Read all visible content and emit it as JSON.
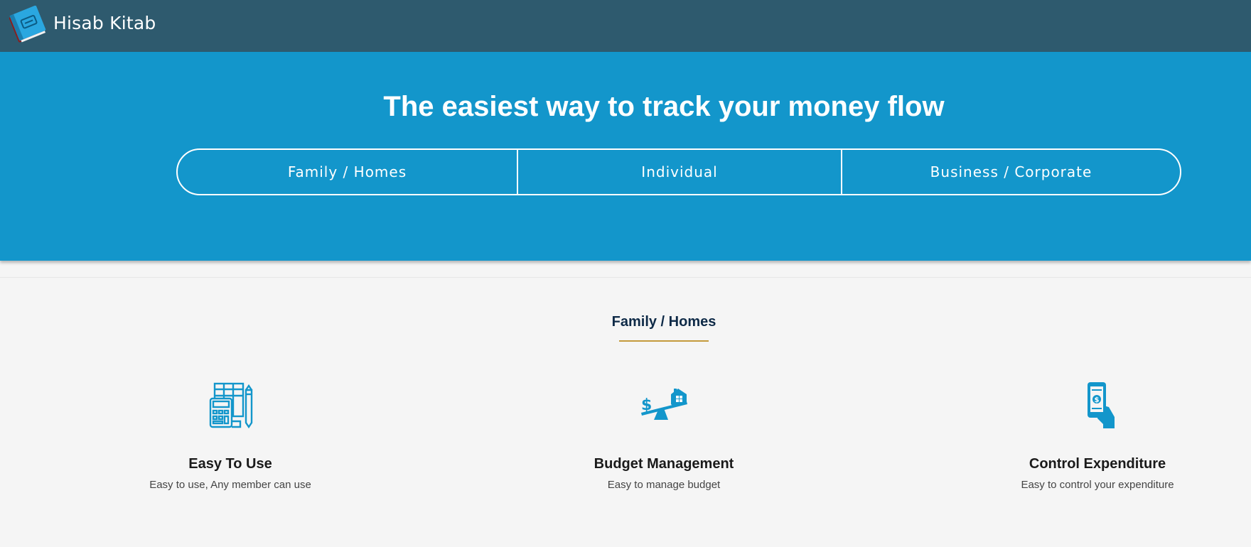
{
  "header": {
    "brand": "Hisab Kitab",
    "logo_icon": "ledger-book-icon",
    "background": "#2e5a6e"
  },
  "hero": {
    "title": "The easiest way to track your money flow",
    "background": "#1396cb",
    "tabs": [
      {
        "label": "Family / Homes"
      },
      {
        "label": "Individual"
      },
      {
        "label": "Business / Corporate"
      }
    ]
  },
  "section": {
    "title": "Family / Homes",
    "underline_color": "#c49a3c",
    "features": [
      {
        "icon": "calculator-spreadsheet-icon",
        "title": "Easy To Use",
        "desc": "Easy to use, Any member can use"
      },
      {
        "icon": "budget-seesaw-house-icon",
        "title": "Budget Management",
        "desc": "Easy to manage budget"
      },
      {
        "icon": "hand-phone-money-icon",
        "title": "Control Expenditure",
        "desc": "Easy to control your expenditure"
      }
    ]
  }
}
